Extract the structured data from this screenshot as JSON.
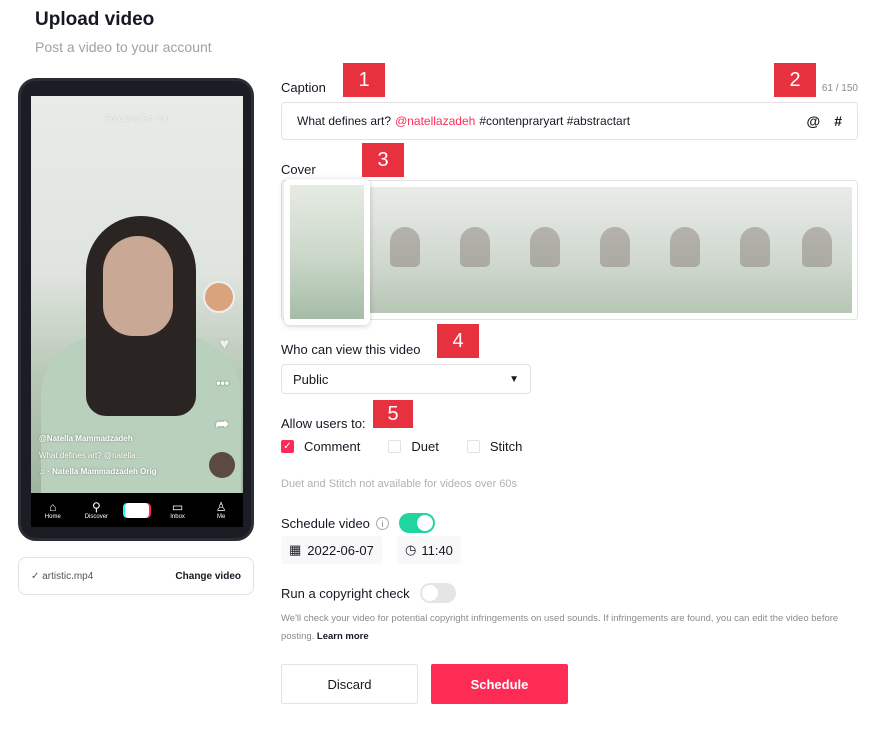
{
  "header": {
    "title": "Upload video",
    "subtitle": "Post a video to your account"
  },
  "phone": {
    "top_tabs": "Following   For You",
    "username": "@Natella Mammadzadeh",
    "caption": "What defines art? @natella...",
    "sound": "· Natella Mammadzadeh Orig",
    "nav": [
      {
        "icon": "home-icon",
        "glyph": "⌂",
        "label": "Home"
      },
      {
        "icon": "search-icon",
        "glyph": "⚲",
        "label": "Discover"
      },
      {
        "icon": "plus-icon",
        "glyph": "+",
        "label": ""
      },
      {
        "icon": "inbox-icon",
        "glyph": "▭",
        "label": "Inbox"
      },
      {
        "icon": "profile-icon",
        "glyph": "♙",
        "label": "Me"
      }
    ]
  },
  "file": {
    "name": "artistic.mp4",
    "change_label": "Change video"
  },
  "caption": {
    "label": "Caption",
    "count": "61 / 150",
    "text_before": "What defines art?",
    "mention": "@natellazadeh",
    "text_after": "#contenpraryart #abstractart",
    "at_icon": "@",
    "hash_icon": "#"
  },
  "cover": {
    "label": "Cover"
  },
  "privacy": {
    "label": "Who can view this video",
    "value": "Public"
  },
  "allow": {
    "label": "Allow users to:",
    "options": [
      {
        "label": "Comment",
        "checked": true
      },
      {
        "label": "Duet",
        "checked": false
      },
      {
        "label": "Stitch",
        "checked": false
      }
    ],
    "note": "Duet and Stitch not available for videos over 60s"
  },
  "schedule": {
    "label": "Schedule video",
    "enabled": true,
    "date": "2022-06-07",
    "time": "11:40"
  },
  "copyright": {
    "label": "Run a copyright check",
    "enabled": false,
    "note": "We'll check your video for potential copyright infringements on used sounds. If infringements are found, you can edit the video before posting.",
    "learn_more": "Learn more"
  },
  "buttons": {
    "discard": "Discard",
    "schedule": "Schedule"
  },
  "badges": [
    "1",
    "2",
    "3",
    "4",
    "5"
  ],
  "colors": {
    "accent": "#fe2c55",
    "toggle_on": "#20d5a0",
    "badge": "#e8313f"
  }
}
